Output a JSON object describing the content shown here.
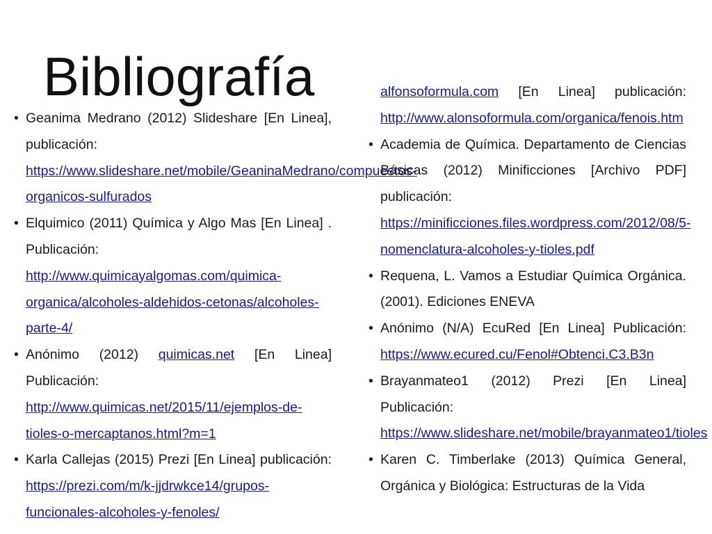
{
  "title": "Bibliografía",
  "left": [
    {
      "pre": "Geanima Medrano (2012) Slideshare [En Linea], publicación: ",
      "link": "https://www.slideshare.net/mobile/GeaninaMedrano/compuestos-organicos-sulfurados",
      "post": ""
    },
    {
      "pre": "Elquimico (2011) Química y Algo Mas [En Linea] . Publicación: ",
      "link": "http://www.quimicayalgomas.com/quimica-organica/alcoholes-aldehidos-cetonas/alcoholes-parte-4/",
      "post": ""
    },
    {
      "pre": " Anónimo (2012) ",
      "link": "quimicas.net",
      "post": " [En Linea] Publicación: ",
      "link2": "http://www.quimicas.net/2015/11/ejemplos-de-tioles-o-mercaptanos.html?m=1"
    },
    {
      "pre": "Karla Callejas (2015) Prezi [En Linea] publicación: ",
      "link": "https://prezi.com/m/k-jjdrwkce14/grupos-funcionales-alcoholes-y-fenoles/",
      "post": ""
    }
  ],
  "right_continuation": {
    "link": "alfonsoformula.com",
    "mid": " [En Linea] publicación: ",
    "link2": "http://www.alonsoformula.com/organica/fenois.htm"
  },
  "right": [
    {
      "pre": "Academia de Química. Departamento de Ciencias Básicas (2012) Minificciones [Archivo PDF] publicación: ",
      "link": "https://minificciones.files.wordpress.com/2012/08/5-nomenclatura-alcoholes-y-tioles.pdf",
      "post": ""
    },
    {
      "pre": "Requena, L. Vamos a Estudiar Química Orgánica. (2001). Ediciones ENEVA",
      "link": "",
      "post": ""
    },
    {
      "pre": "Anónimo (N/A) EcuRed [En Linea] Publicación: ",
      "link": "https://www.ecured.cu/Fenol#Obtenci.C3.B3n",
      "post": ""
    },
    {
      "pre": "Brayanmateo1 (2012) Prezi [En Linea] Publicación: ",
      "link": "https://www.slideshare.net/mobile/brayanmateo1/tioles",
      "post": ""
    },
    {
      "pre": "Karen C. Timberlake (2013) Química General, Orgánica y Biológica: Estructuras de la Vida",
      "link": "",
      "post": ""
    }
  ]
}
